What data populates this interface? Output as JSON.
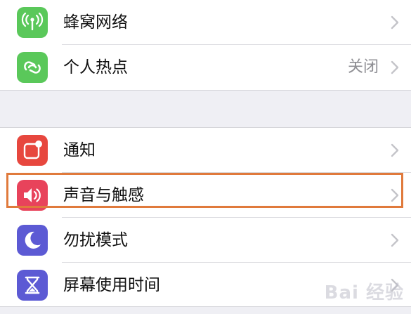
{
  "settings": {
    "group1": [
      {
        "label": "蜂窝网络",
        "value": "",
        "icon": "cellular-antenna-icon",
        "icon_color": "#5ac85a"
      },
      {
        "label": "个人热点",
        "value": "关闭",
        "icon": "hotspot-link-icon",
        "icon_color": "#5ac85a"
      }
    ],
    "group2": [
      {
        "label": "通知",
        "value": "",
        "icon": "notifications-icon",
        "icon_color": "#e7473e"
      },
      {
        "label": "声音与触感",
        "value": "",
        "icon": "speaker-icon",
        "icon_color": "#e8435b"
      },
      {
        "label": "勿扰模式",
        "value": "",
        "icon": "moon-icon",
        "icon_color": "#5c5ad4"
      },
      {
        "label": "屏幕使用时间",
        "value": "",
        "icon": "hourglass-icon",
        "icon_color": "#5c5ad4"
      }
    ]
  },
  "highlight_color": "#e07a3c",
  "watermark": "Bai 经验"
}
